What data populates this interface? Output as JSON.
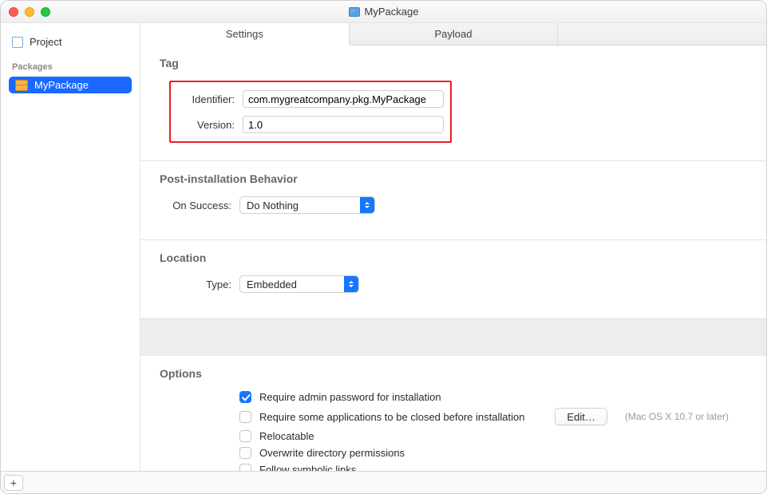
{
  "window": {
    "title": "MyPackage"
  },
  "sidebar": {
    "project_label": "Project",
    "packages_header": "Packages",
    "items": [
      {
        "label": "MyPackage"
      }
    ]
  },
  "tabs": {
    "settings": "Settings",
    "payload": "Payload"
  },
  "tag": {
    "header": "Tag",
    "identifier_label": "Identifier:",
    "identifier_value": "com.mygreatcompany.pkg.MyPackage",
    "version_label": "Version:",
    "version_value": "1.0"
  },
  "post": {
    "header": "Post-installation Behavior",
    "on_success_label": "On Success:",
    "on_success_value": "Do Nothing"
  },
  "location": {
    "header": "Location",
    "type_label": "Type:",
    "type_value": "Embedded"
  },
  "options": {
    "header": "Options",
    "require_admin": "Require admin password for installation",
    "require_close": "Require some applications to be closed before installation",
    "edit_label": "Edit…",
    "edit_hint": "(Mac OS X 10.7 or later)",
    "relocatable": "Relocatable",
    "overwrite": "Overwrite directory permissions",
    "follow_symlinks": "Follow symbolic links"
  },
  "toolbar": {
    "plus": "+"
  }
}
